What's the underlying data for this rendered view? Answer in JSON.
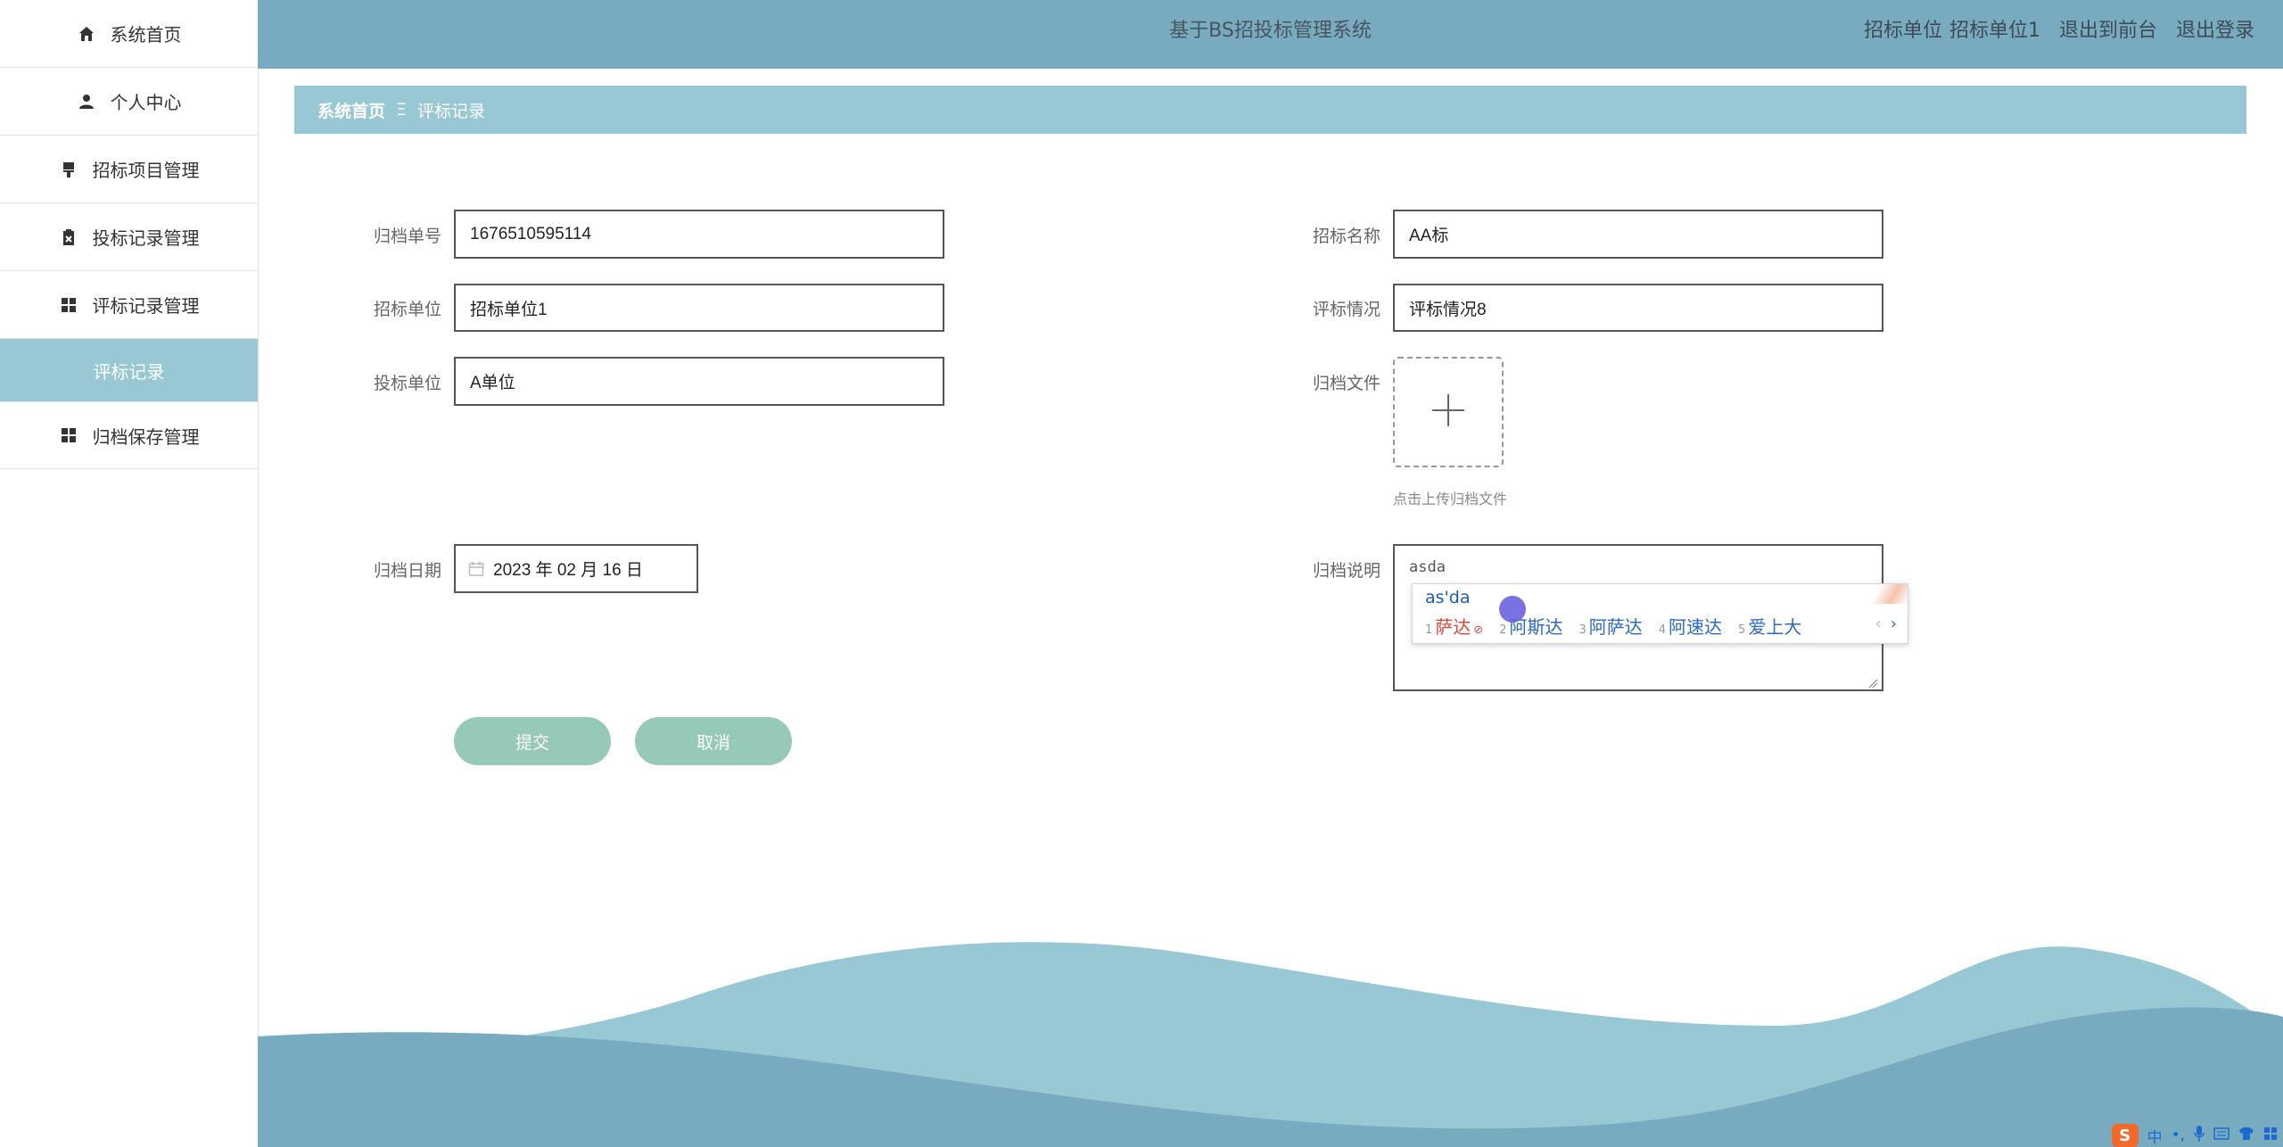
{
  "sidebar": {
    "items": [
      {
        "label": "系统首页",
        "icon": "home-icon"
      },
      {
        "label": "个人中心",
        "icon": "user-icon"
      },
      {
        "label": "招标项目管理",
        "icon": "brush-icon"
      },
      {
        "label": "投标记录管理",
        "icon": "clipboard-x-icon"
      },
      {
        "label": "评标记录管理",
        "icon": "grid-icon"
      },
      {
        "label": "评标记录",
        "active": true
      },
      {
        "label": "归档保存管理",
        "icon": "grid-icon"
      }
    ]
  },
  "header": {
    "title": "基于BS招投标管理系统",
    "user_role": "招标单位",
    "user_name": "招标单位1",
    "back_to_front": "退出到前台",
    "logout": "退出登录"
  },
  "breadcrumb": {
    "home": "系统首页",
    "separator": "Ξ",
    "current": "评标记录"
  },
  "form": {
    "archive_no": {
      "label": "归档单号",
      "value": "1676510595114"
    },
    "tender_unit": {
      "label": "招标单位",
      "value": "招标单位1"
    },
    "bid_unit": {
      "label": "投标单位",
      "value": "A单位"
    },
    "archive_date": {
      "label": "归档日期",
      "value": "2023 年 02 月 16 日"
    },
    "tender_name": {
      "label": "招标名称",
      "value": "AA标"
    },
    "evaluation": {
      "label": "评标情况",
      "value": "评标情况8"
    },
    "archive_file": {
      "label": "归档文件",
      "upload_tip": "点击上传归档文件"
    },
    "archive_desc": {
      "label": "归档说明",
      "value": "asda"
    }
  },
  "buttons": {
    "submit": "提交",
    "cancel": "取消"
  },
  "ime": {
    "composition": "as'da",
    "candidates": [
      {
        "n": "1",
        "text": "萨达"
      },
      {
        "n": "2",
        "text": "阿斯达"
      },
      {
        "n": "3",
        "text": "阿萨达"
      },
      {
        "n": "4",
        "text": "阿速达"
      },
      {
        "n": "5",
        "text": "爱上大"
      }
    ],
    "prev": "‹",
    "next": "›"
  },
  "tray": {
    "logo": "S",
    "lang": "中"
  },
  "colors": {
    "topbar": "#78aac0",
    "breadcrumb": "#99c8d5",
    "button": "#96c9b6",
    "wave_dark": "#78aac0",
    "wave_light": "#99c8d5"
  }
}
